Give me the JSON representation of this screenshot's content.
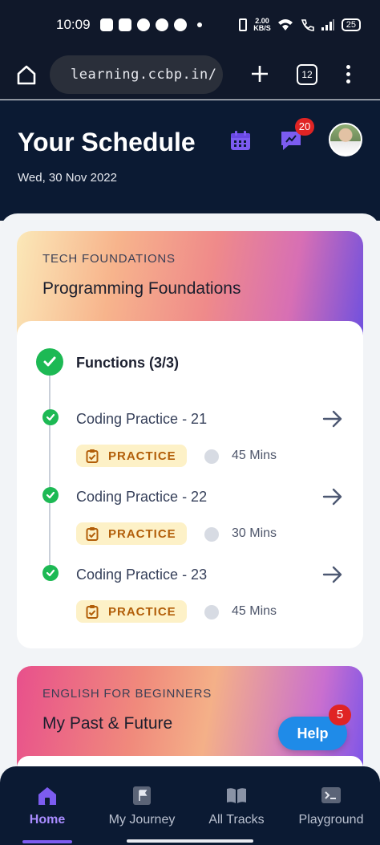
{
  "status_bar": {
    "time": "10:09",
    "net_speed_value": "2.00",
    "net_speed_unit": "KB/S",
    "battery": "25"
  },
  "browser": {
    "url": "learning.ccbp.in/",
    "tab_count": "12"
  },
  "header": {
    "title": "Your Schedule",
    "date": "Wed, 30 Nov 2022",
    "notification_count": "20"
  },
  "courses": [
    {
      "track": "TECH FOUNDATIONS",
      "title": "Programming Foundations",
      "module": {
        "title": "Functions (3/3)",
        "items": [
          {
            "title": "Coding Practice - 21",
            "tag": "PRACTICE",
            "duration": "45 Mins"
          },
          {
            "title": "Coding Practice - 22",
            "tag": "PRACTICE",
            "duration": "30 Mins"
          },
          {
            "title": "Coding Practice - 23",
            "tag": "PRACTICE",
            "duration": "45 Mins"
          }
        ]
      }
    },
    {
      "track": "ENGLISH FOR BEGINNERS",
      "title": "My Past & Future"
    }
  ],
  "help": {
    "label": "Help",
    "badge": "5"
  },
  "bottom_nav": [
    {
      "label": "Home",
      "active": true
    },
    {
      "label": "My Journey",
      "active": false
    },
    {
      "label": "All Tracks",
      "active": false
    },
    {
      "label": "Playground",
      "active": false
    }
  ],
  "colors": {
    "header_bg": "#0b1a33",
    "accent": "#7c5cf0",
    "success": "#1db954",
    "badge": "#e02424",
    "help_button": "#1f8be8",
    "practice_tag_bg": "#fdf1c7",
    "practice_tag_text": "#b25e09"
  }
}
